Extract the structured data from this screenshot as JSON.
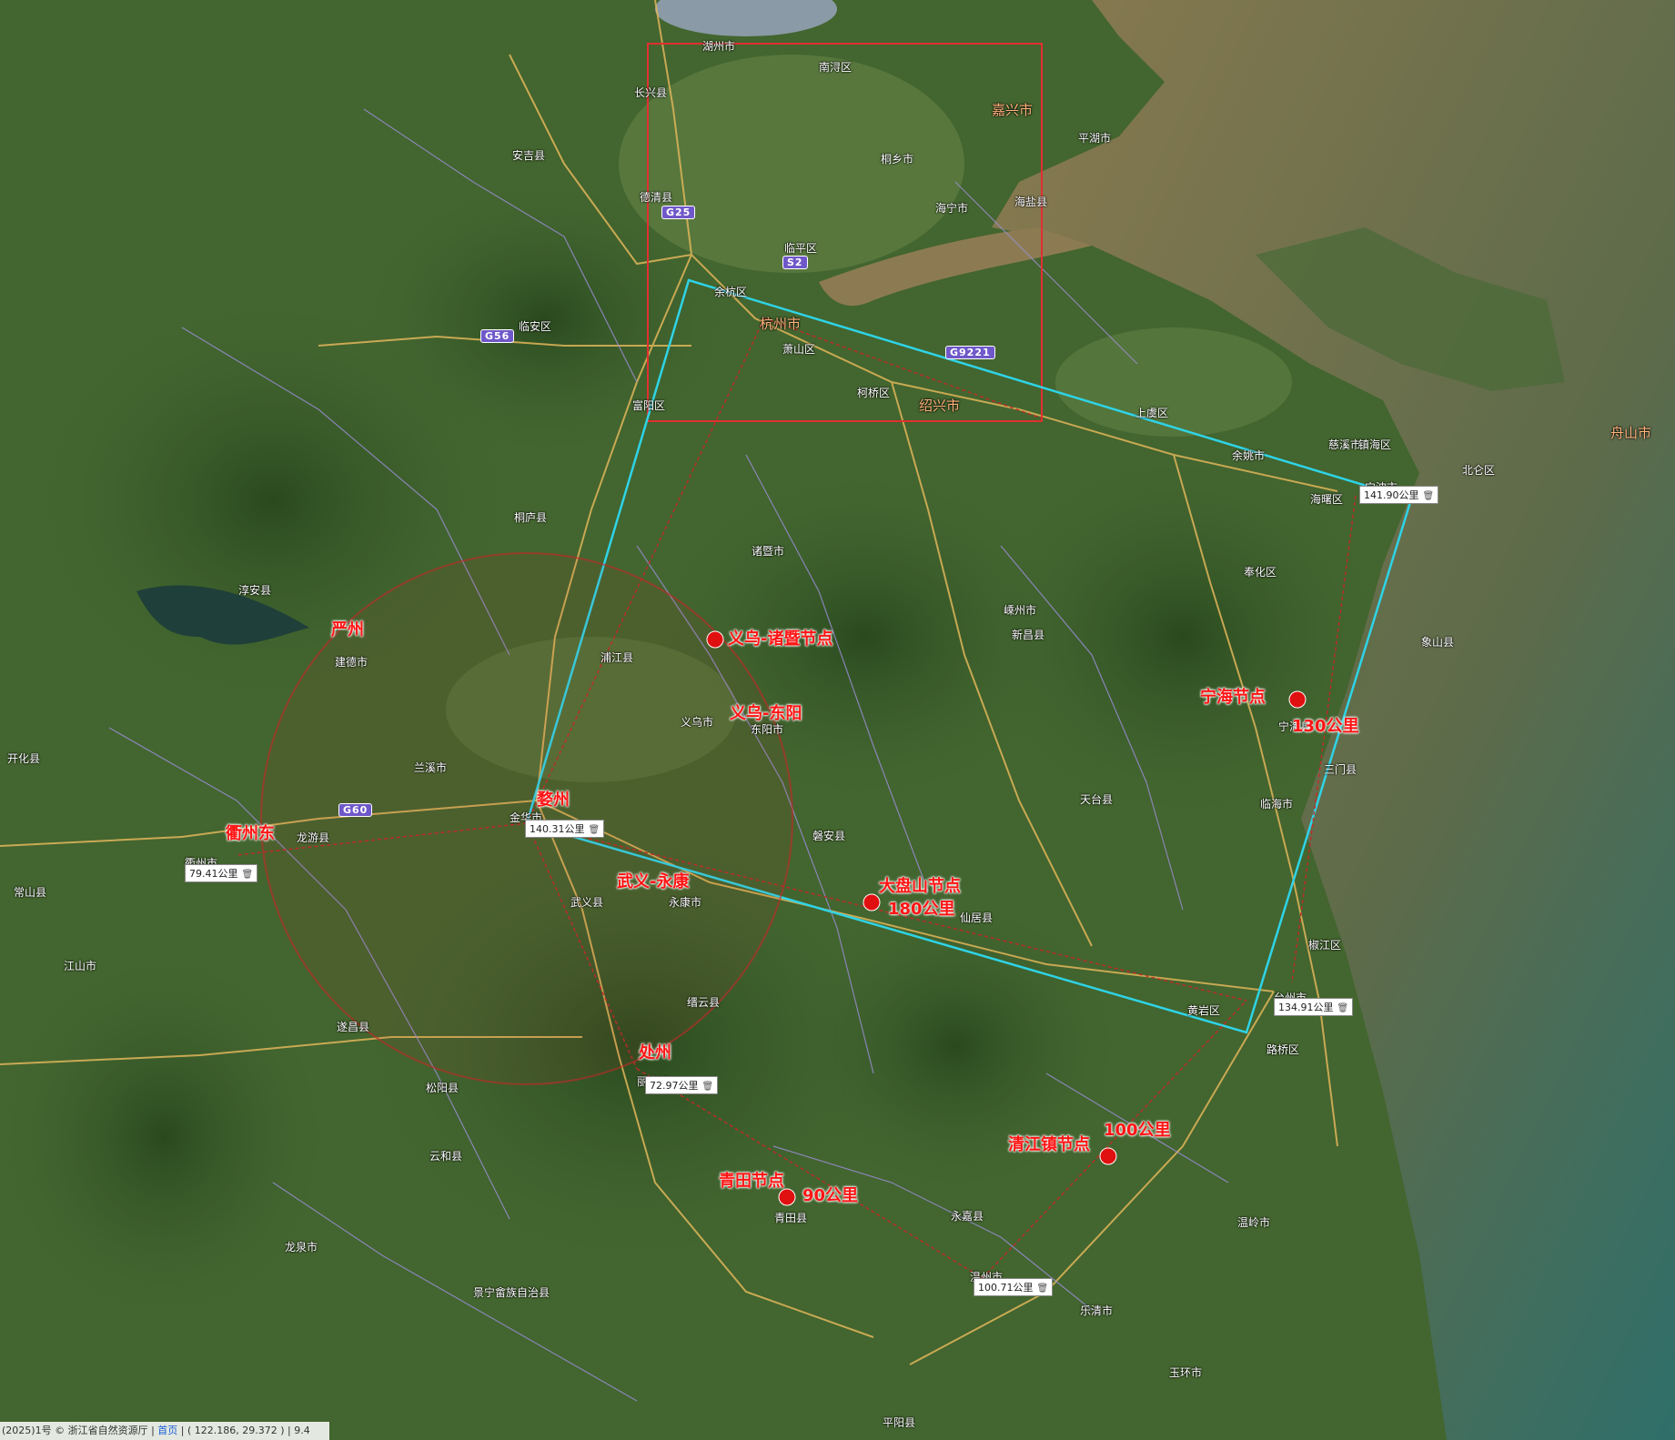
{
  "places": [
    "湖州市",
    "嘉兴市",
    "舟山市",
    "杭州市",
    "绍兴市",
    "宁波市",
    "台州市",
    "丽水市",
    "金华市",
    "衢州市",
    "临安区",
    "安吉县",
    "德清县",
    "余杭区",
    "临平区",
    "萧山区",
    "富阳区",
    "桐庐县",
    "淳安县",
    "建德市",
    "海宁市",
    "桐乡市",
    "平湖市",
    "海盐县",
    "诸暨市",
    "义乌市",
    "东阳市",
    "永康市",
    "武义县",
    "兰溪市",
    "龙游县",
    "江山市",
    "常山县",
    "开化县",
    "遂昌县",
    "松阳县",
    "缙云县",
    "青田县",
    "温岭市",
    "临海市",
    "三门县",
    "天台县",
    "仙居县",
    "新昌县",
    "嵊州市",
    "上虞区",
    "余姚市",
    "慈溪市",
    "奉化区",
    "宁海县",
    "象山县",
    "浦江县",
    "磐安县",
    "南浔区",
    "长兴县",
    "海曙区",
    "北仑区",
    "镇海区",
    "柯桥区",
    "云和县",
    "景宁畲族自治县",
    "龙泉市",
    "永嘉县",
    "乐清市",
    "温州市",
    "黄岩区",
    "路桥区",
    "椒江区",
    "玉环市",
    "平阳县"
  ],
  "annotations": {
    "yiwu_zhuji": "义乌-诸暨节点",
    "yiwu_dongyang": "义乌-东阳",
    "wuyi_yongkang": "武义-永康",
    "dapanshan": "大盘山节点",
    "dapanshan_dist": "180公里",
    "ninghai": "宁海节点",
    "ninghai_dist": "130公里",
    "qingtian": "青田节点",
    "qingtian_dist": "90公里",
    "qingjiang": "清江镇节点",
    "qingjiang_dist": "100公里",
    "yanzhou": "严州",
    "wuzhou": "婺州",
    "quzhou_east": "衢州东",
    "chuzhou": "处州"
  },
  "measurements": {
    "m1": "141.90公里",
    "m2": "140.31公里",
    "m3": "79.41公里",
    "m4": "134.91公里",
    "m5": "72.97公里",
    "m6": "100.71公里",
    "delete_icon": "trash-icon"
  },
  "roads": {
    "g25": "G25",
    "s2": "S2",
    "g56": "G56",
    "g9221": "G9221",
    "g60": "G60"
  },
  "status": {
    "copyright": "(2025)1号 © 浙江省自然资源厅",
    "home": "首页",
    "coords": "( 122.186, 29.372 )",
    "zoom": "9.4"
  },
  "colors": {
    "terrain": "#3d5e2c",
    "sea": "#6a6a3e",
    "box": "#e03030",
    "polygon": "#2fd3e6",
    "circle": "#c62828",
    "node": "#e01010",
    "road_major": "#e0b65a",
    "road_minor": "#9c8fd9"
  }
}
